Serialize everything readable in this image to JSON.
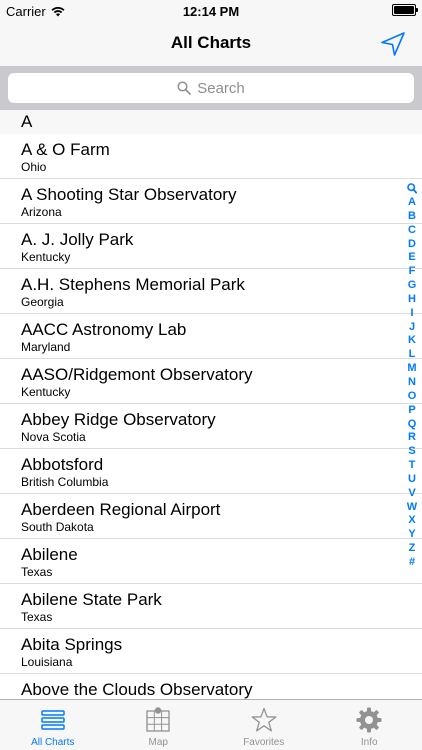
{
  "status": {
    "carrier": "Carrier",
    "time": "12:14 PM"
  },
  "nav": {
    "title": "All Charts",
    "action_icon": "location-arrow-icon"
  },
  "search": {
    "placeholder": "Search"
  },
  "sections": [
    {
      "letter": "A",
      "rows": [
        {
          "title": "A & O Farm",
          "subtitle": "Ohio"
        },
        {
          "title": "A Shooting Star Observatory",
          "subtitle": "Arizona"
        },
        {
          "title": "A. J. Jolly Park",
          "subtitle": "Kentucky"
        },
        {
          "title": "A.H. Stephens Memorial Park",
          "subtitle": "Georgia"
        },
        {
          "title": "AACC Astronomy Lab",
          "subtitle": "Maryland"
        },
        {
          "title": "AASO/Ridgemont Observatory",
          "subtitle": "Kentucky"
        },
        {
          "title": "Abbey Ridge Observatory",
          "subtitle": "Nova Scotia"
        },
        {
          "title": "Abbotsford",
          "subtitle": "British Columbia"
        },
        {
          "title": "Aberdeen Regional Airport",
          "subtitle": "South Dakota"
        },
        {
          "title": "Abilene",
          "subtitle": "Texas"
        },
        {
          "title": "Abilene State Park",
          "subtitle": "Texas"
        },
        {
          "title": "Abita Springs",
          "subtitle": "Louisiana"
        },
        {
          "title": "Above the Clouds Observatory",
          "subtitle": ""
        }
      ]
    }
  ],
  "index": [
    "A",
    "B",
    "C",
    "D",
    "E",
    "F",
    "G",
    "H",
    "I",
    "J",
    "K",
    "L",
    "M",
    "N",
    "O",
    "P",
    "Q",
    "R",
    "S",
    "T",
    "U",
    "V",
    "W",
    "X",
    "Y",
    "Z",
    "#"
  ],
  "tabs": [
    {
      "label": "All Charts",
      "icon": "list-icon",
      "active": true
    },
    {
      "label": "Map",
      "icon": "map-icon",
      "active": false
    },
    {
      "label": "Favorites",
      "icon": "star-icon",
      "active": false
    },
    {
      "label": "Info",
      "icon": "gear-icon",
      "active": false
    }
  ],
  "colors": {
    "accent": "#007aff",
    "inactive": "#929292"
  }
}
